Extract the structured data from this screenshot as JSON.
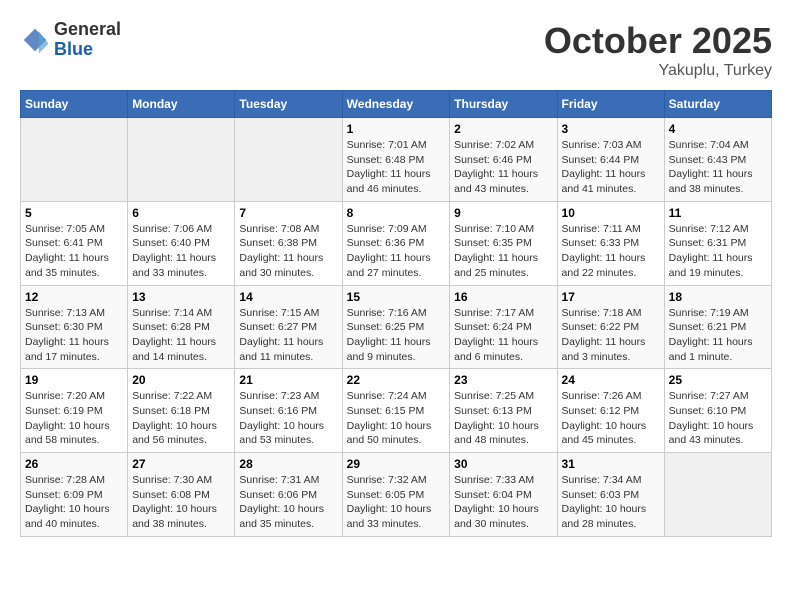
{
  "header": {
    "logo": {
      "general": "General",
      "blue": "Blue"
    },
    "title": "October 2025",
    "location": "Yakuplu, Turkey"
  },
  "weekdays": [
    "Sunday",
    "Monday",
    "Tuesday",
    "Wednesday",
    "Thursday",
    "Friday",
    "Saturday"
  ],
  "weeks": [
    [
      {
        "day": "",
        "sunrise": "",
        "sunset": "",
        "daylight": ""
      },
      {
        "day": "",
        "sunrise": "",
        "sunset": "",
        "daylight": ""
      },
      {
        "day": "",
        "sunrise": "",
        "sunset": "",
        "daylight": ""
      },
      {
        "day": "1",
        "sunrise": "Sunrise: 7:01 AM",
        "sunset": "Sunset: 6:48 PM",
        "daylight": "Daylight: 11 hours and 46 minutes."
      },
      {
        "day": "2",
        "sunrise": "Sunrise: 7:02 AM",
        "sunset": "Sunset: 6:46 PM",
        "daylight": "Daylight: 11 hours and 43 minutes."
      },
      {
        "day": "3",
        "sunrise": "Sunrise: 7:03 AM",
        "sunset": "Sunset: 6:44 PM",
        "daylight": "Daylight: 11 hours and 41 minutes."
      },
      {
        "day": "4",
        "sunrise": "Sunrise: 7:04 AM",
        "sunset": "Sunset: 6:43 PM",
        "daylight": "Daylight: 11 hours and 38 minutes."
      }
    ],
    [
      {
        "day": "5",
        "sunrise": "Sunrise: 7:05 AM",
        "sunset": "Sunset: 6:41 PM",
        "daylight": "Daylight: 11 hours and 35 minutes."
      },
      {
        "day": "6",
        "sunrise": "Sunrise: 7:06 AM",
        "sunset": "Sunset: 6:40 PM",
        "daylight": "Daylight: 11 hours and 33 minutes."
      },
      {
        "day": "7",
        "sunrise": "Sunrise: 7:08 AM",
        "sunset": "Sunset: 6:38 PM",
        "daylight": "Daylight: 11 hours and 30 minutes."
      },
      {
        "day": "8",
        "sunrise": "Sunrise: 7:09 AM",
        "sunset": "Sunset: 6:36 PM",
        "daylight": "Daylight: 11 hours and 27 minutes."
      },
      {
        "day": "9",
        "sunrise": "Sunrise: 7:10 AM",
        "sunset": "Sunset: 6:35 PM",
        "daylight": "Daylight: 11 hours and 25 minutes."
      },
      {
        "day": "10",
        "sunrise": "Sunrise: 7:11 AM",
        "sunset": "Sunset: 6:33 PM",
        "daylight": "Daylight: 11 hours and 22 minutes."
      },
      {
        "day": "11",
        "sunrise": "Sunrise: 7:12 AM",
        "sunset": "Sunset: 6:31 PM",
        "daylight": "Daylight: 11 hours and 19 minutes."
      }
    ],
    [
      {
        "day": "12",
        "sunrise": "Sunrise: 7:13 AM",
        "sunset": "Sunset: 6:30 PM",
        "daylight": "Daylight: 11 hours and 17 minutes."
      },
      {
        "day": "13",
        "sunrise": "Sunrise: 7:14 AM",
        "sunset": "Sunset: 6:28 PM",
        "daylight": "Daylight: 11 hours and 14 minutes."
      },
      {
        "day": "14",
        "sunrise": "Sunrise: 7:15 AM",
        "sunset": "Sunset: 6:27 PM",
        "daylight": "Daylight: 11 hours and 11 minutes."
      },
      {
        "day": "15",
        "sunrise": "Sunrise: 7:16 AM",
        "sunset": "Sunset: 6:25 PM",
        "daylight": "Daylight: 11 hours and 9 minutes."
      },
      {
        "day": "16",
        "sunrise": "Sunrise: 7:17 AM",
        "sunset": "Sunset: 6:24 PM",
        "daylight": "Daylight: 11 hours and 6 minutes."
      },
      {
        "day": "17",
        "sunrise": "Sunrise: 7:18 AM",
        "sunset": "Sunset: 6:22 PM",
        "daylight": "Daylight: 11 hours and 3 minutes."
      },
      {
        "day": "18",
        "sunrise": "Sunrise: 7:19 AM",
        "sunset": "Sunset: 6:21 PM",
        "daylight": "Daylight: 11 hours and 1 minute."
      }
    ],
    [
      {
        "day": "19",
        "sunrise": "Sunrise: 7:20 AM",
        "sunset": "Sunset: 6:19 PM",
        "daylight": "Daylight: 10 hours and 58 minutes."
      },
      {
        "day": "20",
        "sunrise": "Sunrise: 7:22 AM",
        "sunset": "Sunset: 6:18 PM",
        "daylight": "Daylight: 10 hours and 56 minutes."
      },
      {
        "day": "21",
        "sunrise": "Sunrise: 7:23 AM",
        "sunset": "Sunset: 6:16 PM",
        "daylight": "Daylight: 10 hours and 53 minutes."
      },
      {
        "day": "22",
        "sunrise": "Sunrise: 7:24 AM",
        "sunset": "Sunset: 6:15 PM",
        "daylight": "Daylight: 10 hours and 50 minutes."
      },
      {
        "day": "23",
        "sunrise": "Sunrise: 7:25 AM",
        "sunset": "Sunset: 6:13 PM",
        "daylight": "Daylight: 10 hours and 48 minutes."
      },
      {
        "day": "24",
        "sunrise": "Sunrise: 7:26 AM",
        "sunset": "Sunset: 6:12 PM",
        "daylight": "Daylight: 10 hours and 45 minutes."
      },
      {
        "day": "25",
        "sunrise": "Sunrise: 7:27 AM",
        "sunset": "Sunset: 6:10 PM",
        "daylight": "Daylight: 10 hours and 43 minutes."
      }
    ],
    [
      {
        "day": "26",
        "sunrise": "Sunrise: 7:28 AM",
        "sunset": "Sunset: 6:09 PM",
        "daylight": "Daylight: 10 hours and 40 minutes."
      },
      {
        "day": "27",
        "sunrise": "Sunrise: 7:30 AM",
        "sunset": "Sunset: 6:08 PM",
        "daylight": "Daylight: 10 hours and 38 minutes."
      },
      {
        "day": "28",
        "sunrise": "Sunrise: 7:31 AM",
        "sunset": "Sunset: 6:06 PM",
        "daylight": "Daylight: 10 hours and 35 minutes."
      },
      {
        "day": "29",
        "sunrise": "Sunrise: 7:32 AM",
        "sunset": "Sunset: 6:05 PM",
        "daylight": "Daylight: 10 hours and 33 minutes."
      },
      {
        "day": "30",
        "sunrise": "Sunrise: 7:33 AM",
        "sunset": "Sunset: 6:04 PM",
        "daylight": "Daylight: 10 hours and 30 minutes."
      },
      {
        "day": "31",
        "sunrise": "Sunrise: 7:34 AM",
        "sunset": "Sunset: 6:03 PM",
        "daylight": "Daylight: 10 hours and 28 minutes."
      },
      {
        "day": "",
        "sunrise": "",
        "sunset": "",
        "daylight": ""
      }
    ]
  ]
}
